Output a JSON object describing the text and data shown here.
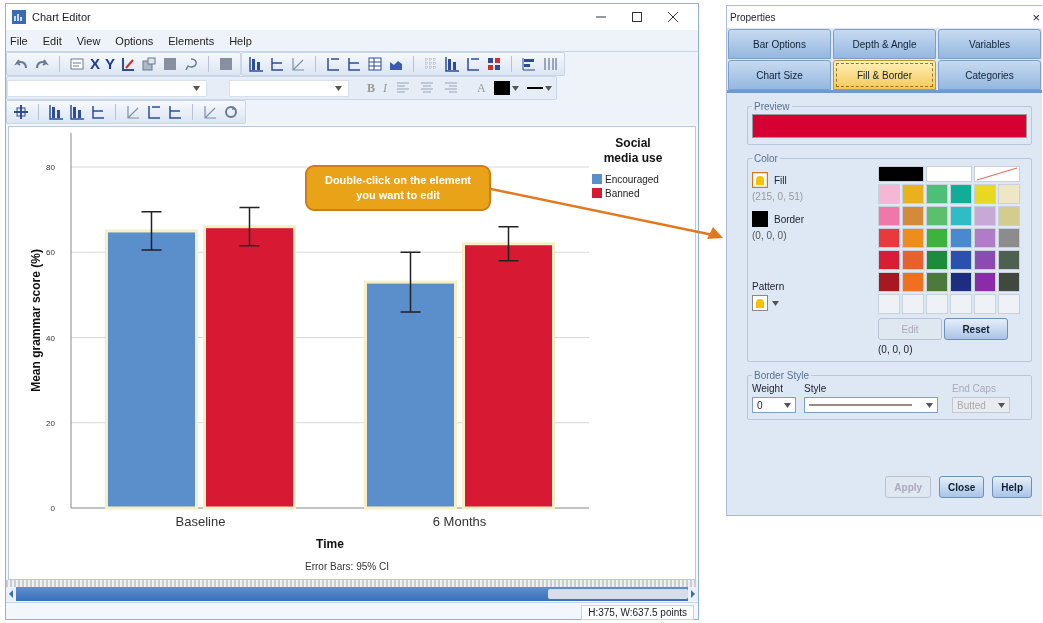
{
  "editor": {
    "window": {
      "title": "Chart Editor"
    },
    "menu": [
      "File",
      "Edit",
      "View",
      "Options",
      "Elements",
      "Help"
    ],
    "toolbar": {
      "axis_letters": [
        "X",
        "Y"
      ],
      "format_letters": [
        "B",
        "I",
        "A"
      ]
    },
    "chart": {
      "footnote": "Error Bars: 95% CI",
      "chart_data": {
        "type": "bar",
        "xlabel": "Time",
        "ylabel": "Mean grammar score (%)",
        "categories": [
          "Baseline",
          "6 Months"
        ],
        "series": [
          {
            "name": "Encouraged",
            "color": "#5b8fcc",
            "values": [
              65,
              53
            ],
            "errors": [
              [
                60.5,
                69.5
              ],
              [
                46,
                60
              ]
            ]
          },
          {
            "name": "Banned",
            "color": "#d71933",
            "values": [
              66,
              62
            ],
            "errors": [
              [
                61.5,
                70.5
              ],
              [
                58,
                66
              ]
            ]
          }
        ],
        "ylim": [
          0,
          88
        ],
        "yticks": [
          0,
          20,
          40,
          60,
          80
        ],
        "grid": true,
        "legend": {
          "title": "Social media use"
        }
      }
    },
    "status_bar": "H:375, W:637.5 points"
  },
  "callout": {
    "text": "Double-click on the element you want to edit"
  },
  "dialog": {
    "title": "Properties",
    "close": "×",
    "tab_rows": [
      [
        {
          "label": "Bar Options",
          "selected": false
        },
        {
          "label": "Depth & Angle",
          "selected": false
        },
        {
          "label": "Variables",
          "selected": false
        }
      ],
      [
        {
          "label": "Chart Size",
          "selected": false
        },
        {
          "label": "Fill & Border",
          "selected": true
        },
        {
          "label": "Categories",
          "selected": false
        }
      ]
    ],
    "preview": {
      "label": "Preview",
      "color": "#d70033"
    },
    "color_group": {
      "label": "Color",
      "targets": [
        {
          "kind": "fill",
          "label": "Fill",
          "value": "(215, 0, 51)",
          "selected": true,
          "color": "#f2c300"
        },
        {
          "kind": "border",
          "label": "Border",
          "value": "(0, 0, 0)",
          "selected": false,
          "color": "#000000"
        }
      ],
      "pattern_label": "Pattern",
      "top_swatches": [
        {
          "kind": "swatch",
          "color": "#000000"
        },
        {
          "kind": "swatch",
          "color": "#ffffff"
        },
        {
          "kind": "none"
        }
      ],
      "palette": [
        {
          "kind": "swatch",
          "color": "#f4b8d4"
        },
        {
          "kind": "swatch",
          "color": "#e8b21e"
        },
        {
          "kind": "swatch",
          "color": "#4fbf78"
        },
        {
          "kind": "swatch",
          "color": "#12ad96"
        },
        {
          "kind": "swatch",
          "color": "#e8d822"
        },
        {
          "kind": "swatch",
          "color": "#efe6c6"
        },
        {
          "kind": "swatch",
          "color": "#ef78a8"
        },
        {
          "kind": "swatch",
          "color": "#d38a3a"
        },
        {
          "kind": "swatch",
          "color": "#5cbf6c"
        },
        {
          "kind": "swatch",
          "color": "#2fbcc4"
        },
        {
          "kind": "swatch",
          "color": "#c8a8d6"
        },
        {
          "kind": "swatch",
          "color": "#d4cc8c"
        },
        {
          "kind": "swatch",
          "color": "#e83a3a"
        },
        {
          "kind": "swatch",
          "color": "#ee8c1c"
        },
        {
          "kind": "swatch",
          "color": "#3cb43c"
        },
        {
          "kind": "swatch",
          "color": "#4a88d0"
        },
        {
          "kind": "swatch",
          "color": "#b07cc8"
        },
        {
          "kind": "swatch",
          "color": "#8c8c8c"
        },
        {
          "kind": "swatch",
          "color": "#d81e36"
        },
        {
          "kind": "swatch",
          "color": "#e8602c"
        },
        {
          "kind": "swatch",
          "color": "#1c8c3c"
        },
        {
          "kind": "swatch",
          "color": "#2a50b0"
        },
        {
          "kind": "swatch",
          "color": "#8a4cb0"
        },
        {
          "kind": "swatch",
          "color": "#506050"
        },
        {
          "kind": "swatch",
          "color": "#a81820"
        },
        {
          "kind": "swatch",
          "color": "#f07020"
        },
        {
          "kind": "swatch",
          "color": "#4c7a3c"
        },
        {
          "kind": "swatch",
          "color": "#1c2e80"
        },
        {
          "kind": "swatch",
          "color": "#8a2ca8"
        },
        {
          "kind": "swatch",
          "color": "#404840"
        },
        {
          "kind": "empty"
        },
        {
          "kind": "empty"
        },
        {
          "kind": "empty"
        },
        {
          "kind": "empty"
        },
        {
          "kind": "empty"
        },
        {
          "kind": "empty"
        }
      ],
      "buttons": [
        {
          "label": "Edit",
          "disabled": true
        },
        {
          "label": "Reset",
          "disabled": false
        }
      ],
      "rgb_readout": "(0, 0, 0)"
    },
    "border_style": {
      "label": "Border Style",
      "weight": {
        "label": "Weight",
        "value": "0"
      },
      "style": {
        "label": "Style"
      },
      "end_caps": {
        "label": "End Caps",
        "value": "Butted",
        "disabled": true
      }
    },
    "buttons": [
      {
        "label": "Apply",
        "disabled": true
      },
      {
        "label": "Close",
        "disabled": false
      },
      {
        "label": "Help",
        "disabled": false
      }
    ]
  }
}
